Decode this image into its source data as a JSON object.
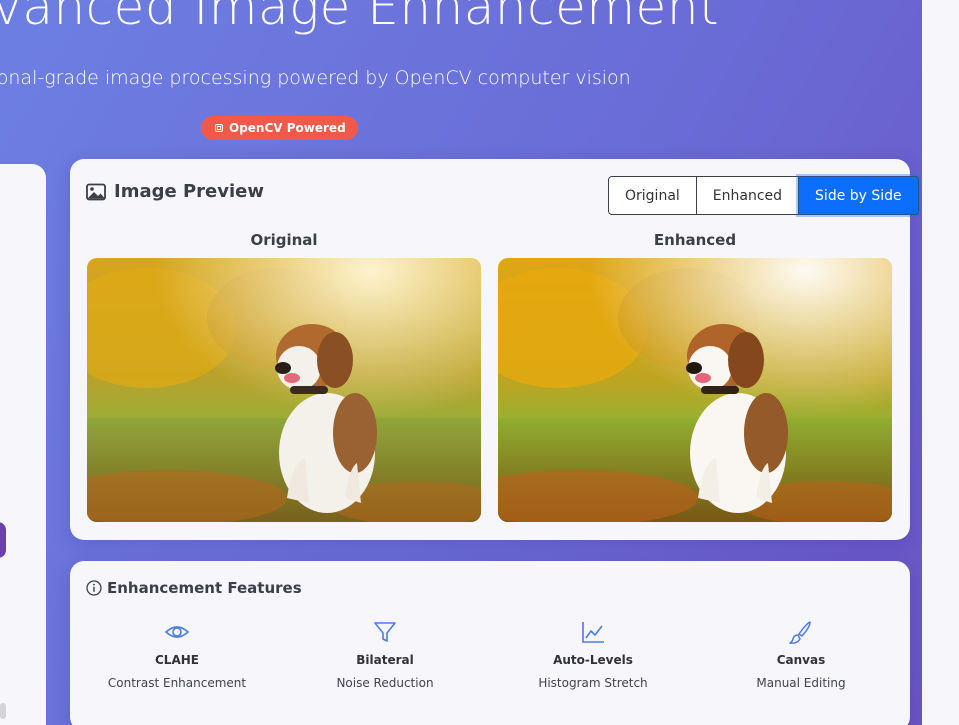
{
  "hero": {
    "title": "dvanced Image Enhancement",
    "subtitle": "essional-grade image processing powered by OpenCV computer vision",
    "badge": "OpenCV Powered"
  },
  "preview": {
    "title": "Image Preview",
    "view_modes": [
      "Original",
      "Enhanced",
      "Side by Side"
    ],
    "active_mode": "Side by Side",
    "labels": {
      "original": "Original",
      "enhanced": "Enhanced"
    }
  },
  "features": {
    "title": "Enhancement Features",
    "items": [
      {
        "name": "CLAHE",
        "desc": "Contrast Enhancement",
        "icon": "eye-icon"
      },
      {
        "name": "Bilateral",
        "desc": "Noise Reduction",
        "icon": "filter-icon"
      },
      {
        "name": "Auto-Levels",
        "desc": "Histogram Stretch",
        "icon": "graph-up-icon"
      },
      {
        "name": "Canvas",
        "desc": "Manual Editing",
        "icon": "brush-icon"
      }
    ]
  },
  "colors": {
    "accent": "#0d6efd",
    "badge": "#f15a4a",
    "feature_icon": "#4d7ce6"
  }
}
